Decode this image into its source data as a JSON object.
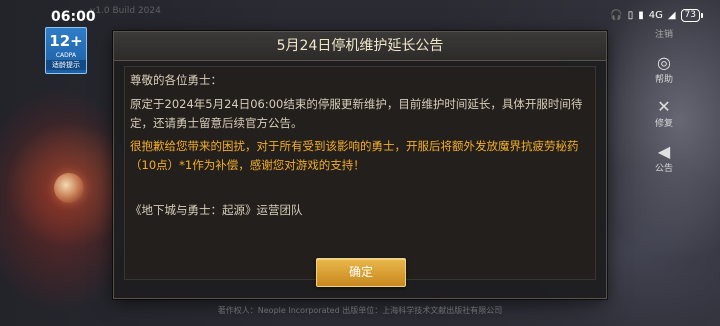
{
  "status_bar": {
    "time": "06:00",
    "faint_text": "v1.0 Build 2024",
    "network": "4G",
    "battery": "73"
  },
  "age_rating": {
    "age": "12+",
    "org": "CADPA",
    "tip": "适龄提示"
  },
  "side_menu": {
    "top_label": "注销",
    "items": [
      {
        "label": "帮助",
        "icon": "help-icon"
      },
      {
        "label": "修复",
        "icon": "wrench-icon"
      },
      {
        "label": "公告",
        "icon": "megaphone-icon"
      }
    ]
  },
  "dialog": {
    "title": "5月24日停机维护延长公告",
    "greeting": "尊敬的各位勇士：",
    "paragraph1": "原定于2024年5月24日06:00结束的停服更新维护，目前维护时间延长，具体开服时间待定，还请勇士留意后续官方公告。",
    "paragraph2": "很抱歉给您带来的困扰，对于所有受到该影响的勇士，开服后将额外发放魔界抗疲劳秘药（10点）*1作为补偿，感谢您对游戏的支持！",
    "signature": "《地下城与勇士：起源》运营团队",
    "confirm_label": "确定"
  },
  "footer": "著作权人：Neople Incorporated 出版单位：上海科学技术文献出版社有限公司",
  "colors": {
    "highlight": "#f4ad2a",
    "button": "#d89a2c",
    "text": "#d7cdb9"
  }
}
